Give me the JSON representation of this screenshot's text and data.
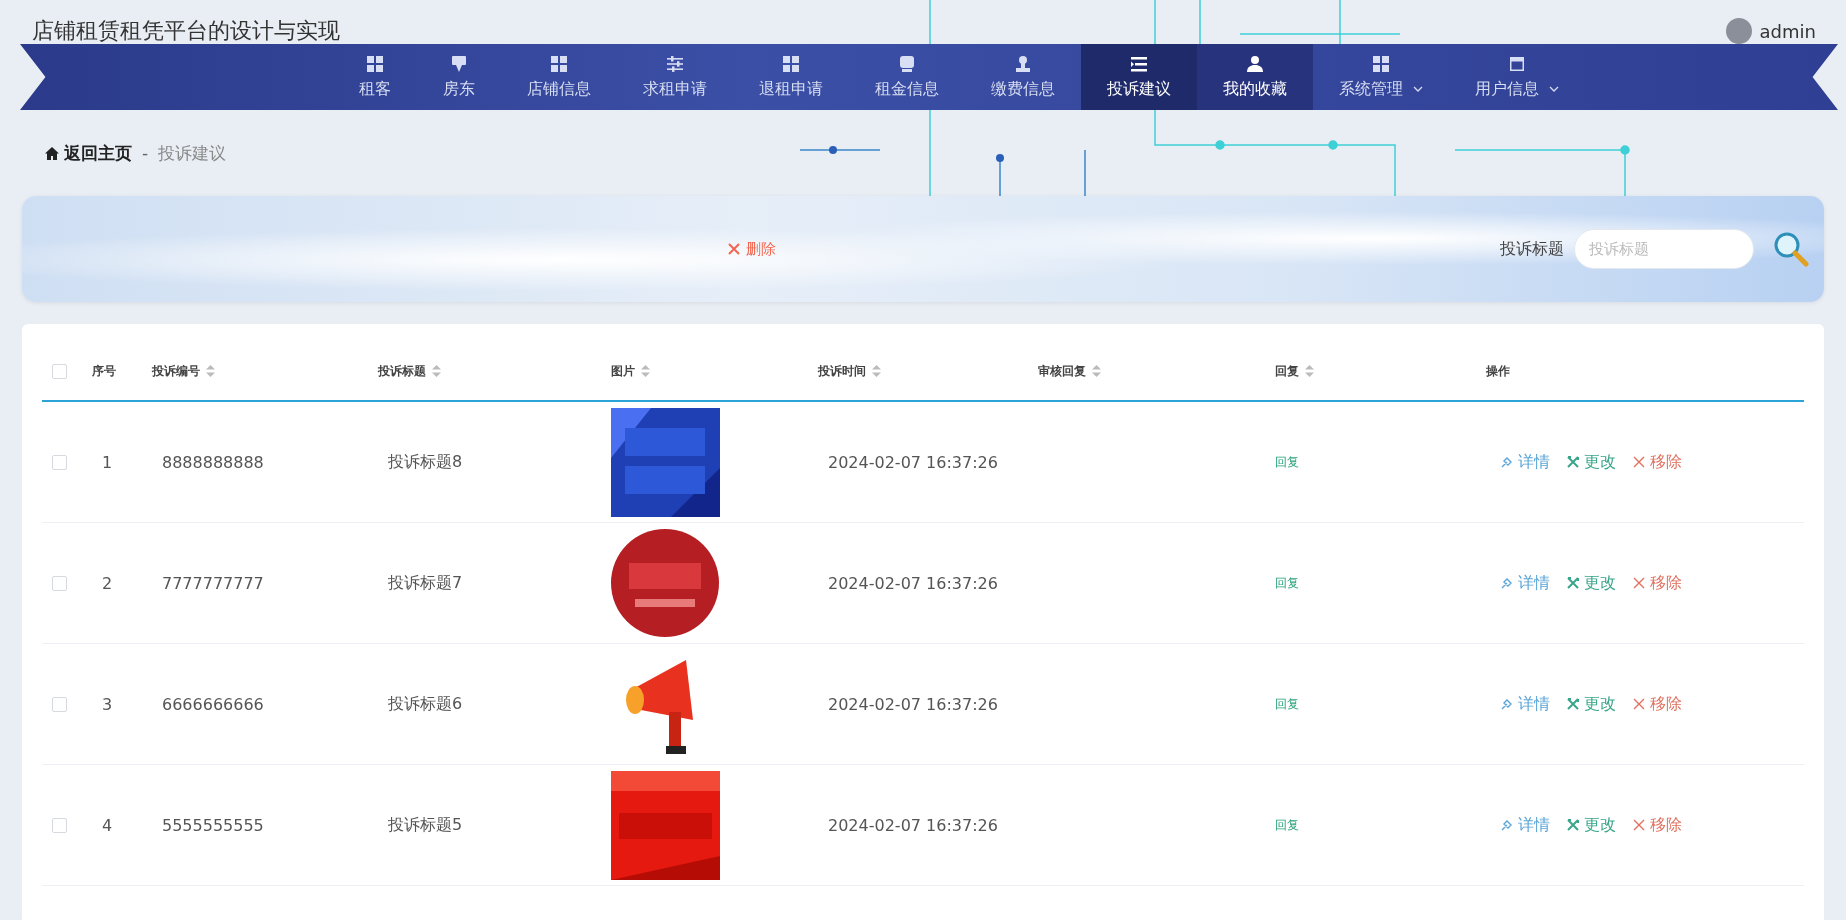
{
  "app_title": "店铺租赁租凭平台的设计与实现",
  "user": {
    "name": "admin"
  },
  "nav": [
    {
      "label": "租客",
      "selected": false,
      "hovered": false,
      "dropdown": false
    },
    {
      "label": "房东",
      "selected": false,
      "hovered": false,
      "dropdown": false
    },
    {
      "label": "店铺信息",
      "selected": false,
      "hovered": false,
      "dropdown": false
    },
    {
      "label": "求租申请",
      "selected": false,
      "hovered": false,
      "dropdown": false
    },
    {
      "label": "退租申请",
      "selected": false,
      "hovered": false,
      "dropdown": false
    },
    {
      "label": "租金信息",
      "selected": false,
      "hovered": false,
      "dropdown": false
    },
    {
      "label": "缴费信息",
      "selected": false,
      "hovered": false,
      "dropdown": false
    },
    {
      "label": "投诉建议",
      "selected": true,
      "hovered": false,
      "dropdown": false
    },
    {
      "label": "我的收藏",
      "selected": false,
      "hovered": true,
      "dropdown": false
    },
    {
      "label": "系统管理",
      "selected": false,
      "hovered": false,
      "dropdown": true
    },
    {
      "label": "用户信息",
      "selected": false,
      "hovered": false,
      "dropdown": true
    }
  ],
  "breadcrumb": {
    "home": "返回主页",
    "separator": "-",
    "current": "投诉建议"
  },
  "toolbar": {
    "delete_button": "删除",
    "search_label": "投诉标题",
    "search_placeholder": "投诉标题"
  },
  "table": {
    "select_all_checked": false,
    "columns": [
      {
        "label": "序号",
        "sortable": false
      },
      {
        "label": "投诉编号",
        "sortable": true
      },
      {
        "label": "投诉标题",
        "sortable": true
      },
      {
        "label": "图片",
        "sortable": true
      },
      {
        "label": "投诉时间",
        "sortable": true
      },
      {
        "label": "审核回复",
        "sortable": true
      },
      {
        "label": "回复",
        "sortable": true
      },
      {
        "label": "操作",
        "sortable": false
      }
    ],
    "rows": [
      {
        "checked": false,
        "index": "1",
        "code": "8888888888",
        "title": "投诉标题8",
        "picture": {
          "kind": "picture"
        },
        "time": "2024-02-07 16:37:26",
        "reply": "回复",
        "actions": [
          "详情",
          "更改",
          "移除"
        ]
      },
      {
        "checked": false,
        "index": "2",
        "code": "7777777777",
        "title": "投诉标题7",
        "picture": {
          "kind": "picture"
        },
        "time": "2024-02-07 16:37:26",
        "reply": "回复",
        "actions": [
          "详情",
          "更改",
          "移除"
        ]
      },
      {
        "checked": false,
        "index": "3",
        "code": "6666666666",
        "title": "投诉标题6",
        "picture": {
          "kind": "picture"
        },
        "time": "2024-02-07 16:37:26",
        "reply": "回复",
        "actions": [
          "详情",
          "更改",
          "移除"
        ]
      },
      {
        "checked": false,
        "index": "4",
        "code": "5555555555",
        "title": "投诉标题5",
        "picture": {
          "kind": "picture"
        },
        "time": "2024-02-07 16:37:26",
        "reply": "回复",
        "actions": [
          "详情",
          "更改",
          "移除"
        ]
      }
    ]
  }
}
